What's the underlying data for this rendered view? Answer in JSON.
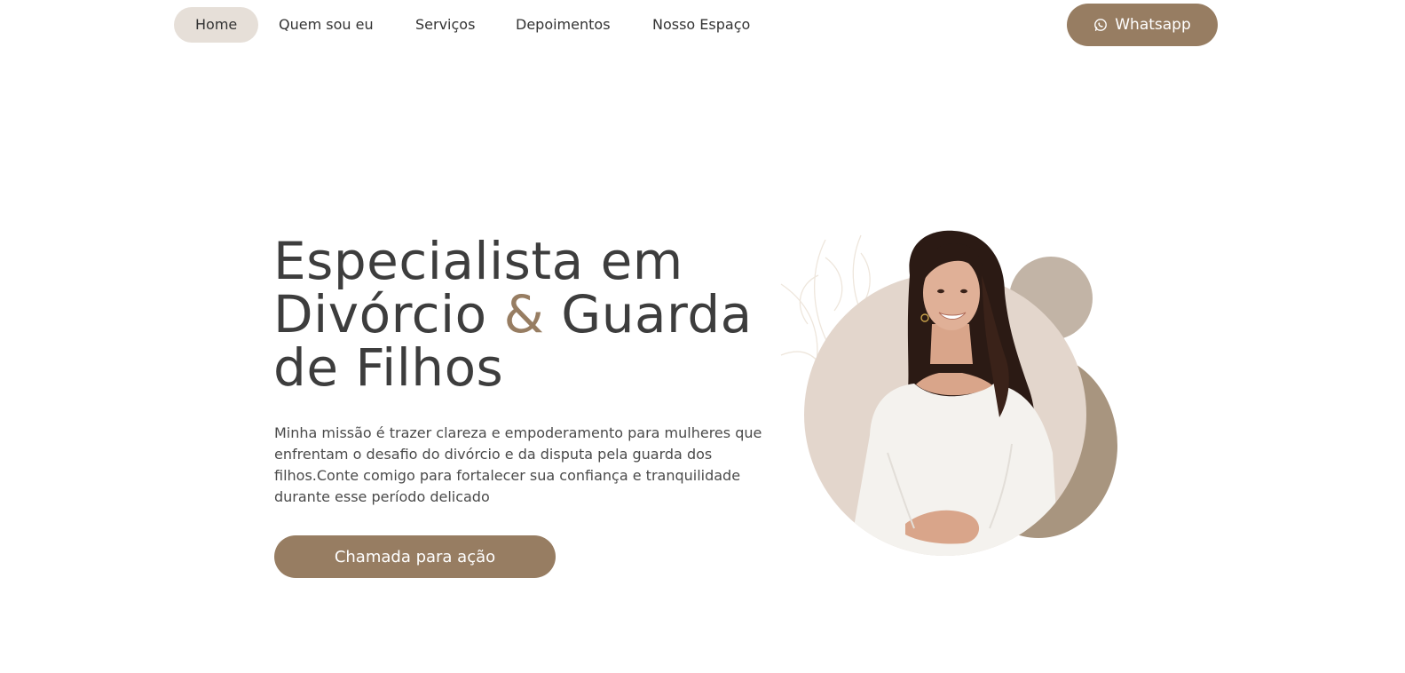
{
  "nav": {
    "items": [
      {
        "label": "Home",
        "active": true
      },
      {
        "label": "Quem sou eu",
        "active": false
      },
      {
        "label": "Serviços",
        "active": false
      },
      {
        "label": "Depoimentos",
        "active": false
      },
      {
        "label": "Nosso Espaço",
        "active": false
      }
    ],
    "whatsapp": {
      "label": "Whatsapp",
      "icon": "whatsapp-icon"
    }
  },
  "hero": {
    "title_line1": "Especialista em",
    "title_line2_a": "Divórcio ",
    "title_amp": "&",
    "title_line2_b": " Guarda",
    "title_line3": "de Filhos",
    "description": "Minha missão é trazer clareza e empoderamento para mulheres que enfrentam o desafio do divórcio e da disputa pela guarda dos filhos.Conte comigo para fortalecer sua confiança e tranquilidade durante esse período delicado",
    "cta_label": "Chamada para ação"
  },
  "colors": {
    "accent": "#977d62",
    "nav_active_bg": "#e6dfd8",
    "circle_light": "#e3d6cc",
    "blob_mid": "#c2b4a6",
    "blob_dark": "#a8957f",
    "text_dark": "#3d3d3d"
  }
}
